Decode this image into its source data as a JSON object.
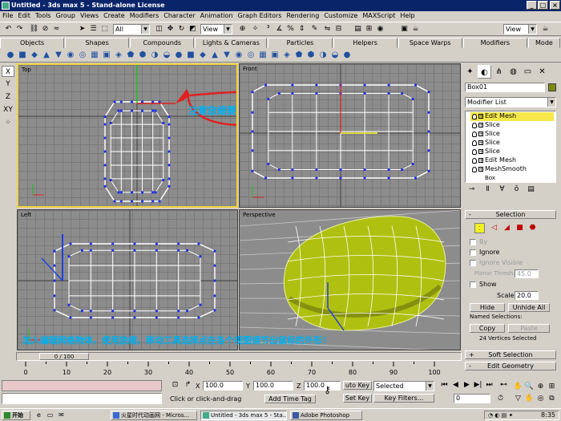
{
  "window": {
    "title": "Untitled - 3ds max 5 - Stand-alone License"
  },
  "menu": [
    "File",
    "Edit",
    "Tools",
    "Group",
    "Views",
    "Create",
    "Modifiers",
    "Character",
    "Animation",
    "Graph Editors",
    "Rendering",
    "Customize",
    "MAXScript",
    "Help"
  ],
  "toolbar": {
    "selection_filter": "All",
    "ref_coord_left": "View",
    "ref_coord_right": "View"
  },
  "tabs": [
    "Objects",
    "Shapes",
    "Compounds",
    "Lights & Cameras",
    "Particles",
    "Helpers",
    "Space Warps",
    "Modifiers",
    "Mode"
  ],
  "axis_strip": [
    "X",
    "Y",
    "Z",
    "XY"
  ],
  "viewports": {
    "top": {
      "label": "Top",
      "note": "注意放缩要在单独轴向上！"
    },
    "front": {
      "label": "Front"
    },
    "left": {
      "label": "Left"
    },
    "perspective": {
      "label": "Perspective"
    },
    "bottom_note": "加入编辑网格物体，使用放缩，移动工具选择点在各个视图调节出鼠标的外形！"
  },
  "command_panel": {
    "object_name": "Box01",
    "modifier_list": "Modifier List",
    "stack": [
      "Edit Mesh",
      "Slice",
      "Slice",
      "Slice",
      "Slice",
      "Edit Mesh",
      "MeshSmooth"
    ],
    "stack_base": "Box",
    "selection_rollout": "Selection",
    "by_label": "By",
    "ignore_label": "Ignore",
    "ignore_visible": "Ignore Visible",
    "planar_thresh_label": "Planar Thresh:",
    "planar_thresh_value": "45.0",
    "show_label": "Show",
    "scale_label": "Scale:",
    "scale_value": "20.0",
    "hide": "Hide",
    "unhide_all": "Unhide All",
    "named_selections": "Named Selections:",
    "copy": "Copy",
    "paste": "Paste",
    "selected_count": "24 Vertices Selected",
    "soft_selection": "Soft Selection",
    "edit_geometry": "Edit Geometry"
  },
  "timeline": {
    "frame": "0 / 100",
    "ticks": [
      "0",
      "10",
      "20",
      "30",
      "40",
      "50",
      "60",
      "70",
      "80",
      "90",
      "100"
    ]
  },
  "status": {
    "x_label": "X",
    "x_value": "100.0",
    "y_label": "Y",
    "y_value": "100.0",
    "z_label": "Z",
    "z_value": "100.0",
    "auto_key": "uto Key",
    "key_mode": "Selected",
    "set_key": "Set Key",
    "key_filters": "Key Filters...",
    "prompt": "Click or click-and-drag",
    "add_time_tag": "Add Time Tag",
    "frame_field": "0"
  },
  "taskbar": {
    "start": "开始",
    "tasks": [
      "火星时代动画网 - Micros...",
      "Untitled - 3ds max 5 - Sta...",
      "Adobe Photoshop"
    ],
    "clock": "8:35"
  },
  "colors": {
    "selected_viewport_border": "#f0d040",
    "vertex": "#2030e0",
    "selected_vertex": "#e02020",
    "annotation": "#00b0f0",
    "mouse_body": "#b0c010"
  }
}
